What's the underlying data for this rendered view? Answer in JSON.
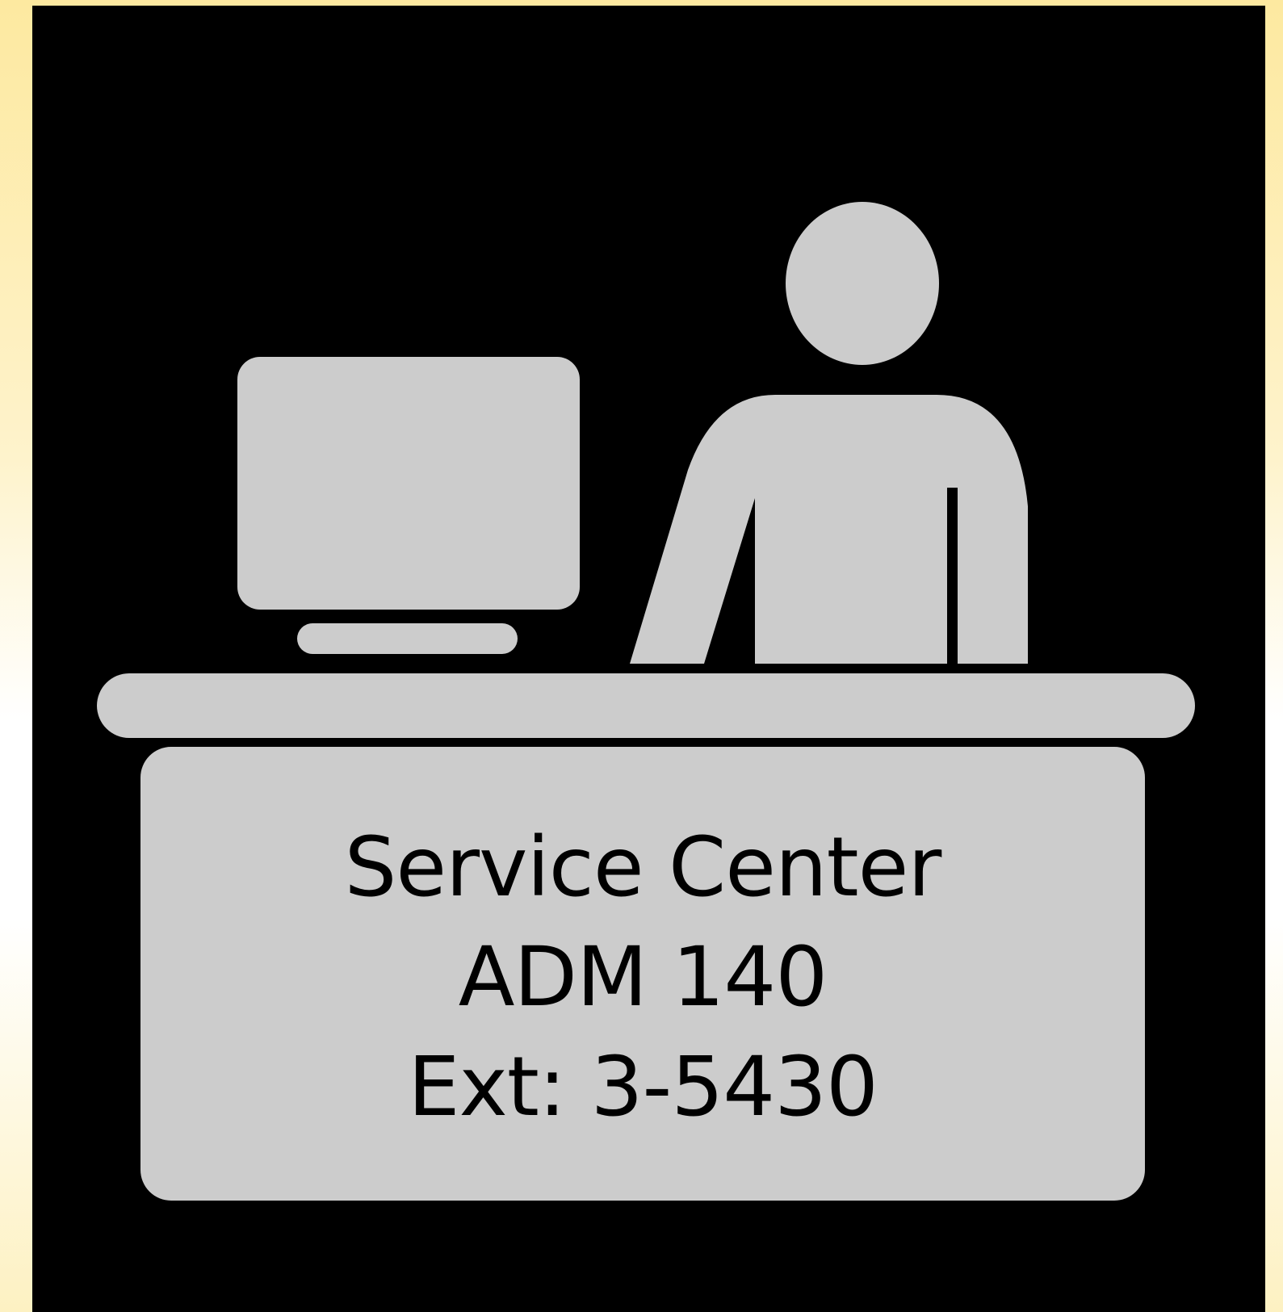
{
  "sign": {
    "title": "Service Center",
    "room": "ADM 140",
    "extension": "Ext: 3-5430"
  },
  "colors": {
    "panel": "#000000",
    "pictogram": "#cccccc",
    "text": "#000000",
    "frame_top": "#fde9a0",
    "frame_bottom": "#fdf1c2"
  },
  "icons": [
    "computer-monitor-icon",
    "keyboard-icon",
    "person-icon",
    "service-desk-icon"
  ]
}
